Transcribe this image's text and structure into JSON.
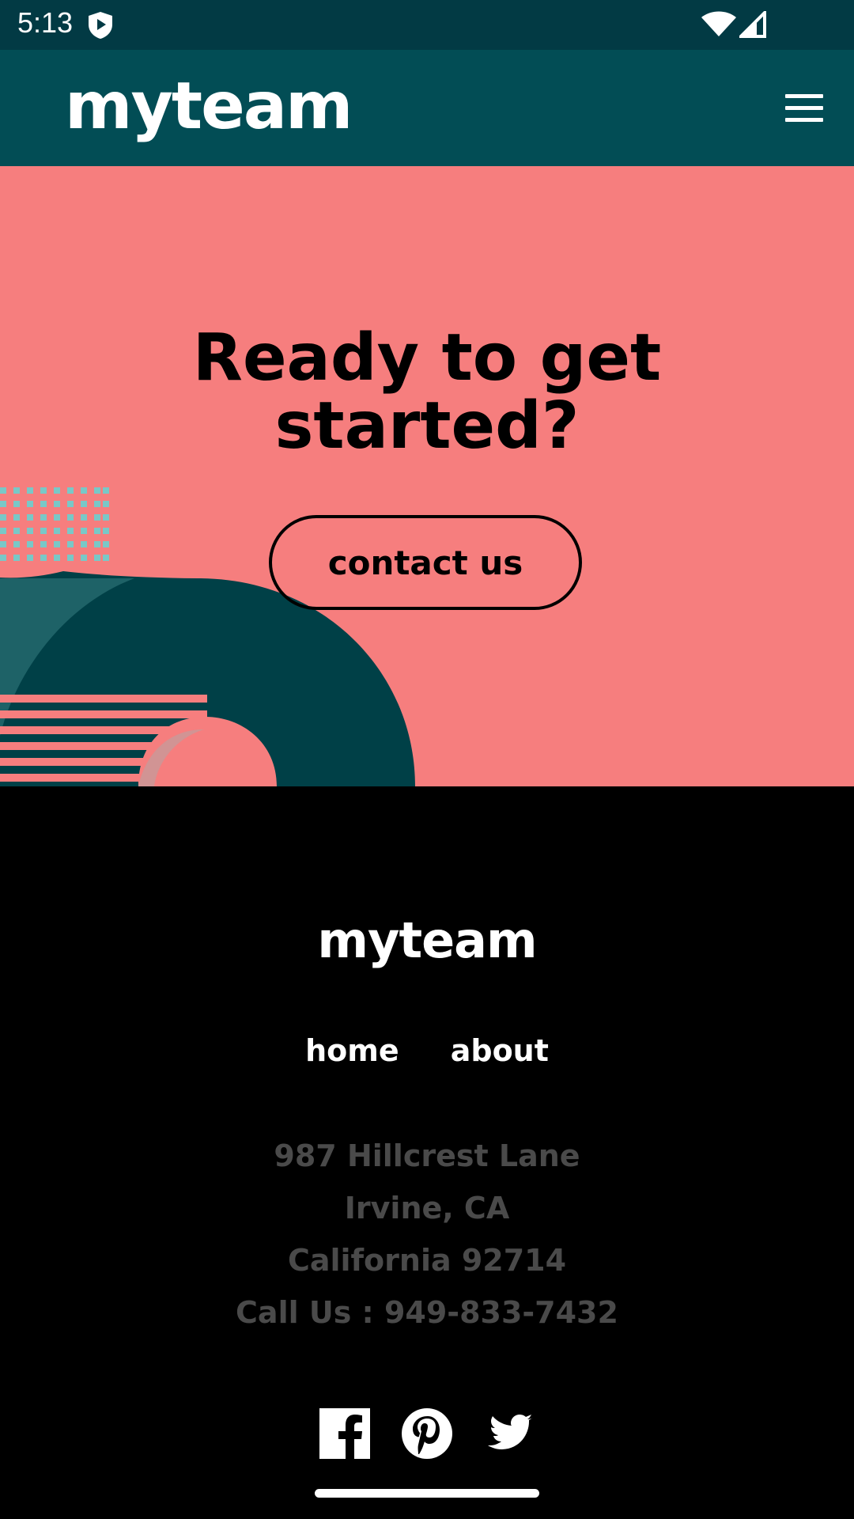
{
  "status_bar": {
    "time": "5:13"
  },
  "header": {
    "logo": "myteam",
    "menu_icon": "hamburger-menu-icon"
  },
  "cta": {
    "title_line1": "Ready to get",
    "title_line2": "started?",
    "button_label": "contact us"
  },
  "footer": {
    "logo": "myteam",
    "nav": [
      {
        "label": "home"
      },
      {
        "label": "about"
      }
    ],
    "address": [
      "987 Hillcrest Lane",
      "Irvine, CA",
      "California 92714",
      "Call Us : 949-833-7432"
    ],
    "social": [
      "facebook-icon",
      "pinterest-icon",
      "twitter-icon"
    ]
  },
  "colors": {
    "status_bar": "#023a44",
    "header": "#024d55",
    "cta_bg": "#f67e7e",
    "dark_teal": "#004047",
    "mint": "#79c8c7",
    "footer_bg": "#000000",
    "address_text": "#4a4a4a"
  }
}
